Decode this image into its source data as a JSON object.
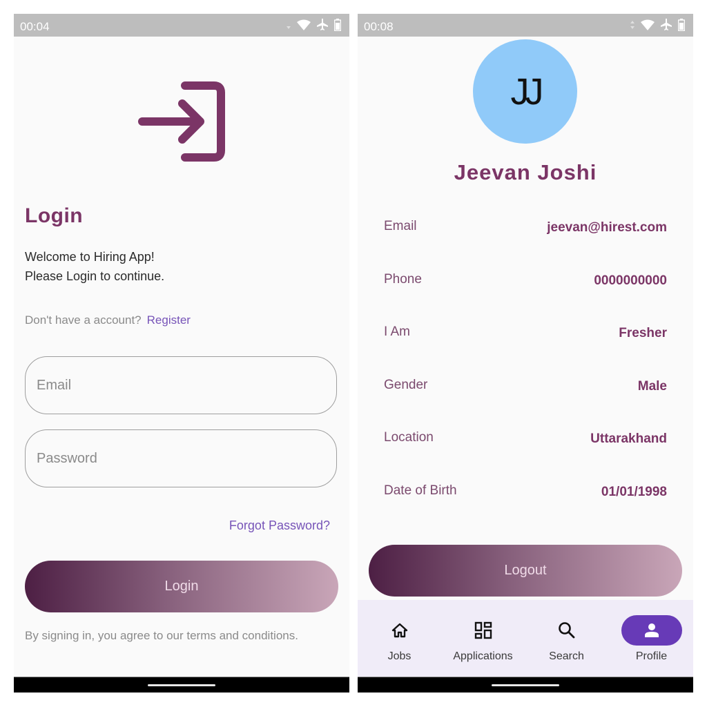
{
  "screens": {
    "login": {
      "status_bar": {
        "time": "00:04",
        "icons": [
          "signal-icon",
          "wifi-icon",
          "airplane-mode-icon",
          "battery-icon"
        ]
      },
      "hero_icon": "login-icon",
      "title": "Login",
      "welcome_line1": "Welcome to Hiring App!",
      "welcome_line2": "Please Login to continue.",
      "register_prompt": "Don't have a account?",
      "register_link": "Register",
      "email_placeholder": "Email",
      "email_value": "",
      "password_placeholder": "Password",
      "password_value": "",
      "forgot_password": "Forgot Password?",
      "login_button": "Login",
      "terms": "By signing in, you agree to our terms and conditions."
    },
    "profile": {
      "status_bar": {
        "time": "00:08",
        "icons": [
          "data-arrows-icon",
          "wifi-icon",
          "airplane-mode-icon",
          "battery-icon"
        ]
      },
      "avatar_initials": "JJ",
      "name": "Jeevan Joshi",
      "fields": [
        {
          "label": "Email",
          "value": "jeevan@hirest.com"
        },
        {
          "label": "Phone",
          "value": "0000000000"
        },
        {
          "label": "I Am",
          "value": "Fresher"
        },
        {
          "label": "Gender",
          "value": "Male"
        },
        {
          "label": "Location",
          "value": "Uttarakhand"
        },
        {
          "label": "Date of Birth",
          "value": "01/01/1998"
        }
      ],
      "logout_button": "Logout",
      "bottom_nav": [
        {
          "label": "Jobs",
          "icon": "home-icon",
          "active": false
        },
        {
          "label": "Applications",
          "icon": "dashboard-icon",
          "active": false
        },
        {
          "label": "Search",
          "icon": "search-icon",
          "active": false
        },
        {
          "label": "Profile",
          "icon": "person-icon",
          "active": true
        }
      ]
    }
  },
  "colors": {
    "primary": "#7b3566",
    "link": "#7754b8",
    "avatar_bg": "#90caf9",
    "nav_active": "#673ab7",
    "gradient_start": "#4d1f44",
    "gradient_end": "#c9a6b8"
  }
}
